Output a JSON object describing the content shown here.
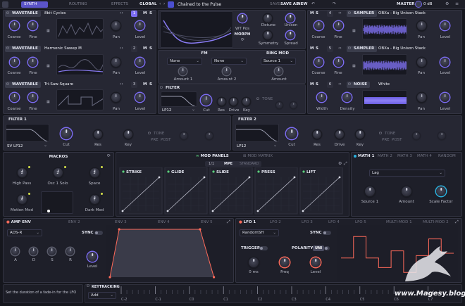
{
  "topbar": {
    "tabs": [
      "SYNTH",
      "ROUTING",
      "EFFECTS",
      "GLOBAL"
    ],
    "preset_name": "Chained to the Pulse",
    "save": "SAVE",
    "save_as": "SAVE AS",
    "new": "NEW",
    "master_label": "MASTER",
    "master_value": "0 dB"
  },
  "osc": [
    {
      "type": "WAVETABLE",
      "name": "8bit Cycles",
      "num": "1",
      "m": "M",
      "s": "S",
      "k1": "Coarse",
      "k2": "Fine",
      "k3": "Pan",
      "k4": "Level"
    },
    {
      "type": "WAVETABLE",
      "name": "Harmonic Sweep M",
      "num": "2",
      "m": "M",
      "s": "S",
      "k1": "Coarse",
      "k2": "Fine",
      "k3": "Pan",
      "k4": "Level"
    },
    {
      "type": "WAVETABLE",
      "name": "Tri-Saw-Square",
      "num": "3",
      "m": "M",
      "s": "S",
      "k1": "Coarse",
      "k2": "Fine",
      "k3": "Pan",
      "k4": "Level"
    }
  ],
  "osc_main": {
    "wt_pos": "WT Pos",
    "detune": "Detune",
    "unison": "Unison",
    "morph": "MORPH",
    "symmetry": "Symmetry",
    "spread": "Spread"
  },
  "fm": {
    "title": "FM",
    "sel1": "None",
    "sel2": "None",
    "amount1": "Amount 1",
    "amount2": "Amount 2",
    "ring_title": "RING MOD",
    "ring_sel": "Source 1",
    "ring_amount": "Amount"
  },
  "filter_mid": {
    "title": "FILTER",
    "mode": "LP12",
    "cut": "Cut",
    "res": "Res",
    "drive": "Drive",
    "key": "Key",
    "tone": "TONE"
  },
  "right_osc": [
    {
      "m": "M",
      "s": "S",
      "num": "4",
      "type": "SAMPLER",
      "name": "OBXa - Big Unison Stack",
      "k1": "Coarse",
      "k2": "Fine",
      "k3": "Pan",
      "k4": "Level"
    },
    {
      "m": "M",
      "s": "S",
      "num": "5",
      "type": "SAMPLER",
      "name": "OBXa - Big Unison Stack",
      "k1": "Coarse",
      "k2": "Fine",
      "k3": "Pan",
      "k4": "Level"
    },
    {
      "m": "M",
      "s": "S",
      "num": "6",
      "type": "NOISE",
      "name": "White",
      "k1": "Width",
      "k2": "Density",
      "k3": "Pan",
      "k4": "Level"
    }
  ],
  "filter1": {
    "title": "FILTER 1",
    "mode": "SV LP12",
    "cut": "Cut",
    "res": "Res",
    "key": "Key",
    "tone": "TONE",
    "pre": "PRE",
    "post": "POST"
  },
  "filter2": {
    "title": "FILTER 2",
    "mode": "LP12",
    "cut": "Cut",
    "res": "Res",
    "drive": "Drive",
    "key": "Key",
    "tone": "TONE",
    "pre": "PRE",
    "post": "POST"
  },
  "macros": {
    "title": "MACROS",
    "items": [
      {
        "n": "1",
        "label": "High Pass"
      },
      {
        "n": "2",
        "label": "Osc 1 Solo"
      },
      {
        "n": "3",
        "label": "Space"
      },
      {
        "n": "X",
        "label": "Motion Mod"
      },
      {
        "n": "Y",
        "label": "Dark Mod"
      }
    ]
  },
  "modpanels": {
    "title": "MOD PANELS",
    "matrix": "MOD MATRIX",
    "sub": [
      "1/1",
      "MPE",
      "STANDARD"
    ],
    "items": [
      "STRIKE",
      "GLIDE",
      "SLIDE",
      "PRESS",
      "LIFT"
    ]
  },
  "math": {
    "tabs": [
      "MATH 1",
      "MATH 2",
      "MATH 3",
      "MATH 4",
      "RANDOM"
    ],
    "mode": "Lag",
    "k1": "Source 1",
    "k2": "Amount",
    "k3": "Scale Factor"
  },
  "env": {
    "tabs": [
      "AMP ENV",
      "ENV 2",
      "ENV 3",
      "ENV 4",
      "ENV 5"
    ],
    "mode": "ADS-R",
    "sync": "SYNC",
    "k": [
      "A",
      "D",
      "S",
      "R"
    ],
    "level": "Level"
  },
  "lfo": {
    "tabs": [
      "LFO 1",
      "LFO 2",
      "LFO 3",
      "LFO 4",
      "LFO 5",
      "MULTI-MOD 1",
      "MULTI-MOD 2"
    ],
    "shape": "RandomSH",
    "sync": "SYNC",
    "trigger": "TRIGGER",
    "polarity": "POLARITY",
    "uni": "UNI",
    "delay": "0 ms",
    "freq": "Freq",
    "level": "Level"
  },
  "status": "Set the duration of a fade-in for the LFO",
  "keytracking": {
    "title": "KEYTRACKING",
    "mode": "Add",
    "notes": [
      "C-2",
      "C-1",
      "C0",
      "C1",
      "C2",
      "C3",
      "C4",
      "C5",
      "C6",
      "C7"
    ]
  },
  "watermark": "www.Magesy.blog",
  "colors": {
    "accent": "#7c6cf2",
    "env_curve": "#ff6a5a",
    "lfo_curve": "#ff6a5a",
    "bg": "#15161d"
  },
  "chart_data": [
    {
      "type": "line",
      "name": "amp-env",
      "x": [
        0,
        0.08,
        0.78,
        0.9
      ],
      "y": [
        0,
        1,
        1,
        0
      ]
    },
    {
      "type": "line",
      "name": "lfo-randomsh",
      "x": [
        0,
        1,
        2,
        3,
        4,
        5,
        6,
        7,
        8
      ],
      "y": [
        0.4,
        0.85,
        0.4,
        0.2,
        0.55,
        0.1,
        0.45,
        0.8,
        0.5
      ]
    }
  ]
}
